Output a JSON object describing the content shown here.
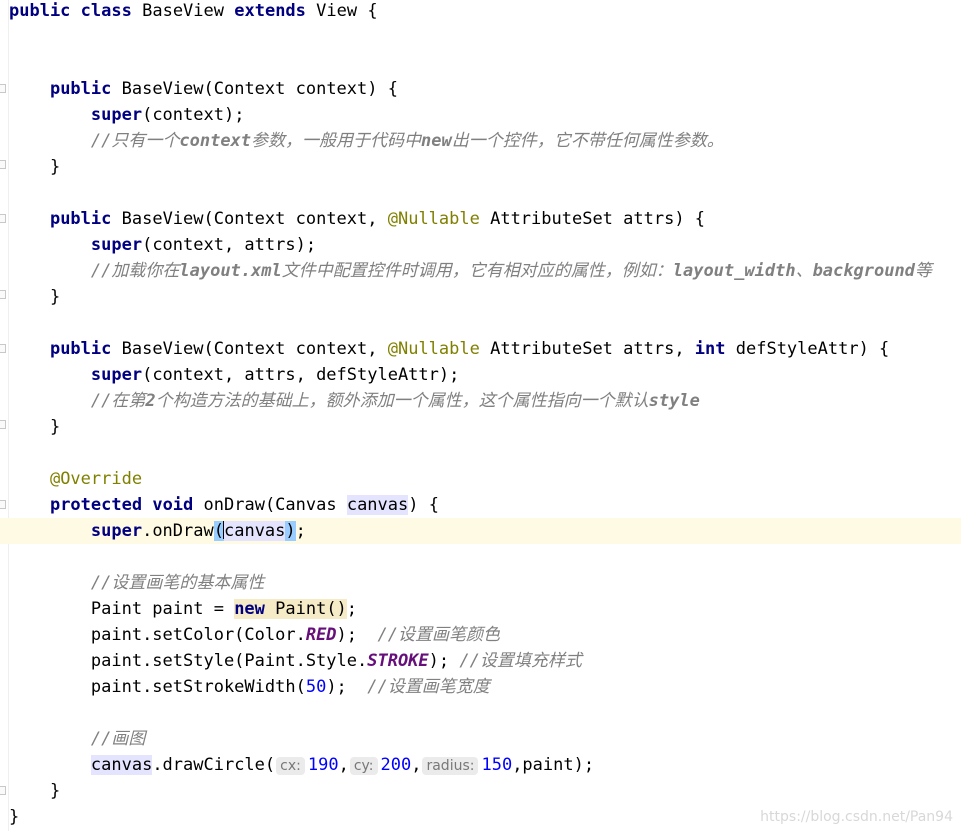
{
  "code": {
    "class_decl": {
      "kw1": "public",
      "kw2": "class",
      "name": "BaseView",
      "kw3": "extends",
      "parent": "View",
      "brace": "{"
    },
    "ctor1": {
      "kw": "public",
      "sig": "BaseView(Context context) {",
      "super_kw": "super",
      "super_args": "(context);",
      "comment_a": "//只有一个",
      "comment_b": "context",
      "comment_c": "参数，一般用于代码中",
      "comment_d": "new",
      "comment_e": "出一个控件，它不带任何属性参数。",
      "close": "}"
    },
    "ctor2": {
      "kw": "public",
      "sig_a": "BaseView(Context context, ",
      "annotation": "@Nullable",
      "sig_b": " AttributeSet attrs) {",
      "super_kw": "super",
      "super_args": "(context, attrs);",
      "comment_a": "//加载你在",
      "comment_b": "layout.xml",
      "comment_c": "文件中配置控件时调用，它有相对应的属性，例如：",
      "comment_d": "layout_width",
      "comment_e": "、",
      "comment_f": "background",
      "comment_g": "等",
      "close": "}"
    },
    "ctor3": {
      "kw": "public",
      "sig_a": "BaseView(Context context, ",
      "annotation": "@Nullable",
      "sig_b": " AttributeSet attrs, ",
      "int_kw": "int",
      "sig_c": " defStyleAttr) {",
      "super_kw": "super",
      "super_args": "(context, attrs, defStyleAttr);",
      "comment_a": "//在第",
      "comment_b": "2",
      "comment_c": "个构造方法的基础上，额外添加一个属性，这个属性指向一个默认",
      "comment_d": "style",
      "close": "}"
    },
    "ondraw": {
      "override": "@Override",
      "kw1": "protected",
      "kw2": "void",
      "sig_a": "onDraw(Canvas ",
      "param": "canvas",
      "sig_b": ") {",
      "super_kw": "super",
      "super_call": ".onDraw",
      "open_paren": "(",
      "super_arg": "canvas",
      "close_paren": ")",
      "semi": ";",
      "comment1": "//设置画笔的基本属性",
      "paint_decl_a": "Paint paint = ",
      "new_kw": "new",
      "paint_decl_b": " Paint()",
      "paint_decl_c": ";",
      "setcolor_a": "paint.setColor(Color.",
      "setcolor_const": "RED",
      "setcolor_b": ");  ",
      "setcolor_cmt": "//设置画笔颜色",
      "setstyle_a": "paint.setStyle(Paint.Style.",
      "setstyle_const": "STROKE",
      "setstyle_b": "); ",
      "setstyle_cmt": "//设置填充样式",
      "setwidth_a": "paint.setStrokeWidth(",
      "setwidth_num": "50",
      "setwidth_b": ");  ",
      "setwidth_cmt": "//设置画笔宽度",
      "comment2": "//画图",
      "draw_var": "canvas",
      "draw_call": ".drawCircle(",
      "hint_cx": "cx:",
      "val_cx": "190",
      "hint_cy": "cy:",
      "val_cy": "200",
      "hint_radius": "radius:",
      "val_radius": "150",
      "draw_end": ",paint);",
      "close": "}"
    },
    "class_close": "}"
  },
  "watermark": "https://blog.csdn.net/Pan94",
  "colors": {
    "keyword": "#000080",
    "annotation": "#808000",
    "comment": "#808080",
    "number": "#0000ff",
    "constant": "#660e7a",
    "current_line": "#fffae3"
  }
}
